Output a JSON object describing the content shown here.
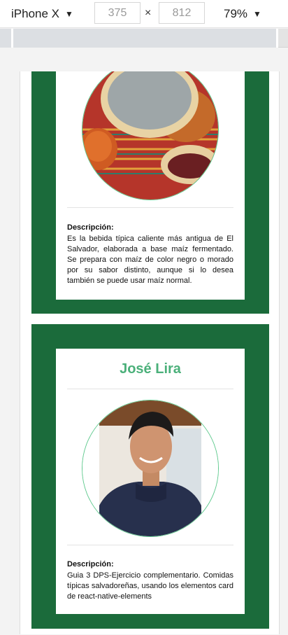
{
  "toolbar": {
    "device": "iPhone X",
    "width": "375",
    "times": "×",
    "height": "812",
    "zoom": "79%"
  },
  "cards": [
    {
      "description_title": "Descripción:",
      "description": "Es la bebida típica caliente más antigua de El Salvador, elaborada a base maíz fermentado. Se prepara con maíz de color negro o morado por su sabor distinto, aunque si lo desea también se puede usar maíz normal."
    },
    {
      "name": "José Lira",
      "description_title": "Descripción:",
      "description": "Guia 3 DPS-Ejercicio complementario. Comidas típicas salvadoreñas, usando los elementos card de react-native-elements"
    }
  ],
  "colors": {
    "card_green": "#1b6b3b",
    "name_green": "#4bb07a",
    "ring_green": "#5ec98d"
  }
}
